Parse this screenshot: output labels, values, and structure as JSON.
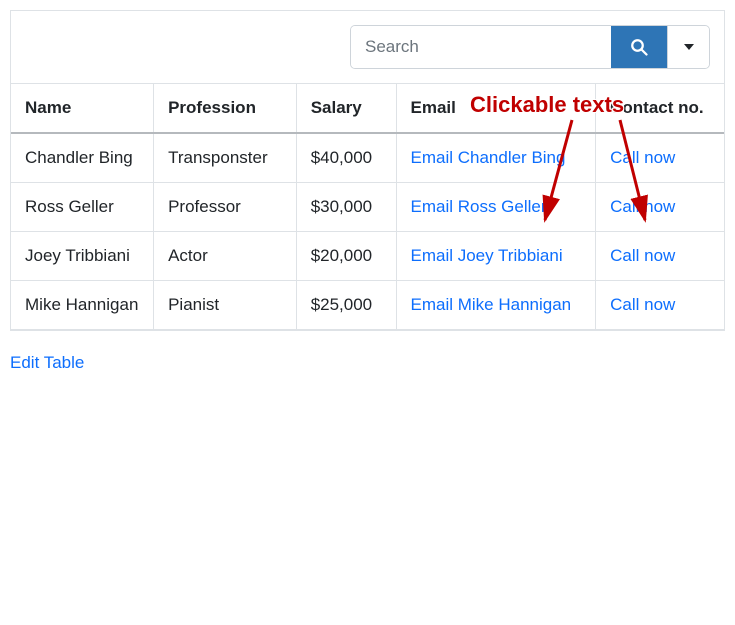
{
  "search": {
    "placeholder": "Search"
  },
  "annotation": {
    "label": "Clickable texts"
  },
  "table": {
    "headers": {
      "name": "Name",
      "profession": "Profession",
      "salary": "Salary",
      "email": "Email",
      "contact": "Contact no."
    },
    "rows": [
      {
        "name": "Chandler Bing",
        "profession": "Transponster",
        "salary": "$40,000",
        "email_text": "Email Chandler Bing",
        "contact_text": "Call now"
      },
      {
        "name": "Ross Geller",
        "profession": "Professor",
        "salary": "$30,000",
        "email_text": "Email Ross Geller",
        "contact_text": "Call now"
      },
      {
        "name": "Joey Tribbiani",
        "profession": "Actor",
        "salary": "$20,000",
        "email_text": "Email Joey Tribbiani",
        "contact_text": "Call now"
      },
      {
        "name": "Mike Hannigan",
        "profession": "Pianist",
        "salary": "$25,000",
        "email_text": "Email Mike Hannigan",
        "contact_text": "Call now"
      }
    ]
  },
  "footer": {
    "edit": "Edit Table"
  }
}
